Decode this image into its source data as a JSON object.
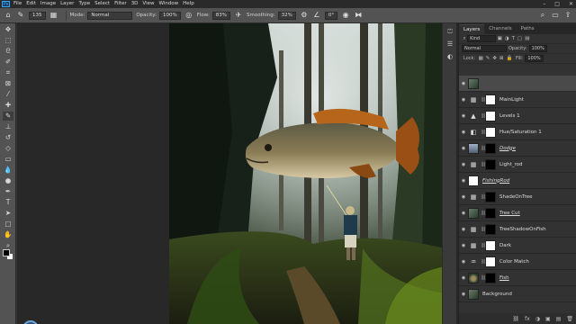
{
  "menu": {
    "logo": "Ps",
    "items": [
      "File",
      "Edit",
      "Image",
      "Layer",
      "Type",
      "Select",
      "Filter",
      "3D",
      "View",
      "Window",
      "Help"
    ],
    "controls": [
      "–",
      "□",
      "✕"
    ]
  },
  "options": {
    "mode_label": "Mode:",
    "mode_value": "Normal",
    "opacity_label": "Opacity:",
    "opacity_value": "100%",
    "flow_label": "Flow:",
    "flow_value": "83%",
    "smoothing_label": "Smoothing:",
    "smoothing_value": "32%",
    "angle_value": "0°",
    "brush_size": "135"
  },
  "layers_panel": {
    "tabs": [
      "Layers",
      "Channels",
      "Paths"
    ],
    "kind_value": "Kind",
    "blend_value": "Normal",
    "opacity_label": "Opacity:",
    "opacity_value": "100%",
    "lock_label": "Lock:",
    "fill_label": "Fill:",
    "fill_value": "100%",
    "layers": [
      {
        "name": "",
        "thumb": "photo",
        "adj": "",
        "mask": "",
        "selected": true
      },
      {
        "name": "MainLight",
        "thumb": "",
        "adj": "▦",
        "mask": "white",
        "selected": false
      },
      {
        "name": "Levels 1",
        "thumb": "",
        "adj": "▲",
        "mask": "white",
        "selected": false
      },
      {
        "name": "Hue/Saturation 1",
        "thumb": "",
        "adj": "◧",
        "mask": "white",
        "selected": false
      },
      {
        "name": "Dodge",
        "thumb": "bluesky",
        "adj": "",
        "mask": "black",
        "selected": false
      },
      {
        "name": "Light_rod",
        "thumb": "",
        "adj": "▦",
        "mask": "black",
        "selected": false
      },
      {
        "name": "FishingRod",
        "thumb": "white",
        "adj": "",
        "mask": "",
        "selected": false
      },
      {
        "name": "ShadeOnTree",
        "thumb": "",
        "adj": "▦",
        "mask": "black",
        "selected": false
      },
      {
        "name": "Tree Cut",
        "thumb": "photo",
        "adj": "",
        "mask": "black",
        "selected": false
      },
      {
        "name": "TreeShadowOnFish",
        "thumb": "",
        "adj": "▦",
        "mask": "black",
        "selected": false
      },
      {
        "name": "Dark",
        "thumb": "",
        "adj": "▦",
        "mask": "white",
        "selected": false
      },
      {
        "name": "Color Match",
        "thumb": "",
        "adj": "♒",
        "mask": "white",
        "selected": false
      },
      {
        "name": "Fish",
        "thumb": "fish",
        "adj": "",
        "mask": "black",
        "selected": false
      },
      {
        "name": "Background",
        "thumb": "photo",
        "adj": "",
        "mask": "",
        "selected": false
      }
    ],
    "footer": [
      "⛓",
      "fx",
      "◑",
      "▣",
      "▤",
      "🗑"
    ]
  }
}
